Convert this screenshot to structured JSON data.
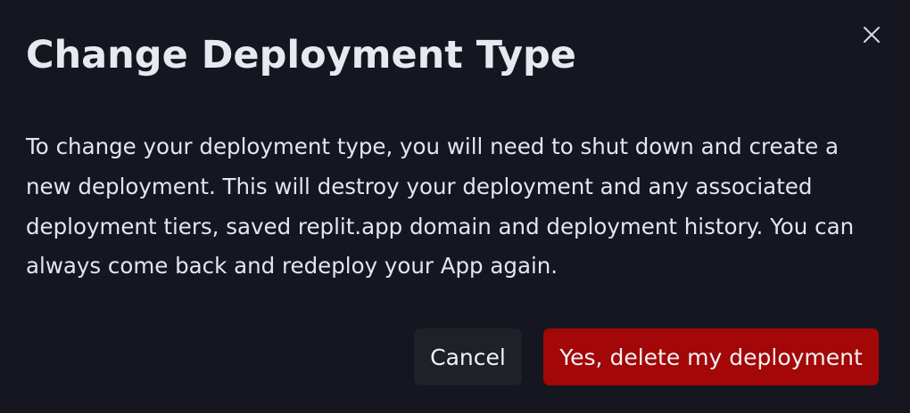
{
  "dialog": {
    "title": "Change Deployment Type",
    "close_icon": "close-icon",
    "body": "To change your deployment type, you will need to shut down and create a new deployment. This will destroy your deployment and any associated deployment tiers, saved replit.app domain and deployment history. You can always come back and redeploy your App again.",
    "cancel_label": "Cancel",
    "confirm_label": "Yes, delete my deployment"
  },
  "colors": {
    "background": "#15161f",
    "title_text": "#e7e8f0",
    "body_text": "#e4e5ee",
    "cancel_bg": "#1f2129",
    "danger_bg": "#a30707"
  }
}
